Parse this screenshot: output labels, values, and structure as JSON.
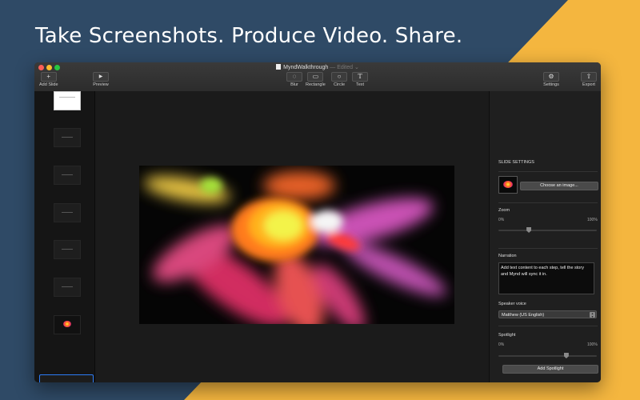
{
  "headline": "Take Screenshots. Produce Video. Share.",
  "window": {
    "doc_title": "MyndWalkthrough",
    "doc_status": "— Edited ⌄"
  },
  "toolbar": {
    "add_slide": {
      "label": "Add Slide",
      "icon": "plus-icon",
      "glyph": "+"
    },
    "preview": {
      "label": "Preview",
      "icon": "play-icon",
      "glyph": "▶"
    },
    "blur": {
      "label": "Blur",
      "icon": "blur-icon",
      "glyph": "◌"
    },
    "rectangle": {
      "label": "Rectangle",
      "icon": "rectangle-icon",
      "glyph": "▭"
    },
    "circle": {
      "label": "Circle",
      "icon": "circle-icon",
      "glyph": "○"
    },
    "text": {
      "label": "Text",
      "icon": "text-icon",
      "glyph": "T"
    },
    "settings": {
      "label": "Settings",
      "icon": "gear-icon",
      "glyph": "⚙"
    },
    "export": {
      "label": "Export",
      "icon": "share-icon",
      "glyph": "⇧"
    }
  },
  "inspector": {
    "slide_settings": "SLIDE SETTINGS",
    "choose_image": "Choose an image...",
    "zoom": {
      "label": "Zoom",
      "min": "0%",
      "max": "100%",
      "value": 0.3
    },
    "narration": {
      "label": "Narration",
      "text": "Add text content to each step, tell the story and Mynd will sync it in."
    },
    "speaker_voice": {
      "label": "Speaker voice",
      "value": "Matthew (US English)"
    },
    "spotlight": {
      "label": "Spotlight",
      "min": "0%",
      "max": "100%",
      "value": 0.7,
      "button": "Add Spotlight"
    }
  },
  "colors": {
    "background_blue": "#2f4a66",
    "background_yellow": "#f4b63f",
    "selection": "#2d7cf6"
  }
}
